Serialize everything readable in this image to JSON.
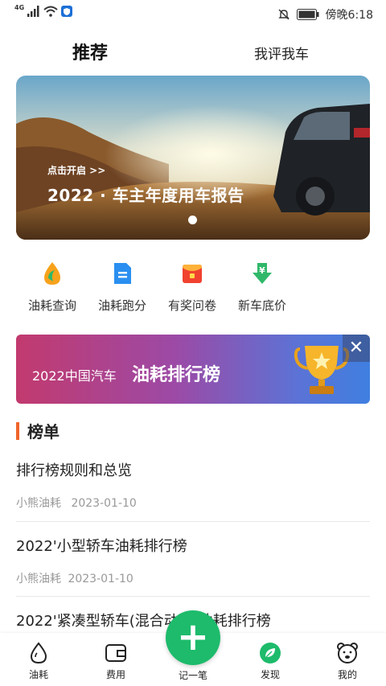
{
  "status_bar": {
    "network": "4G",
    "time": "傍晚6:18"
  },
  "header": {
    "tabs": [
      {
        "label": "推荐",
        "active": true
      },
      {
        "label": "我评我车",
        "active": false
      }
    ]
  },
  "banner": {
    "subtitle": "点击开启 >>",
    "title": "2022 · 车主年度用车报告"
  },
  "quick_actions": [
    {
      "label": "油耗查询",
      "icon": "fuel-drop-icon"
    },
    {
      "label": "油耗跑分",
      "icon": "document-icon"
    },
    {
      "label": "有奖问卷",
      "icon": "red-envelope-icon"
    },
    {
      "label": "新车底价",
      "icon": "yen-download-icon"
    }
  ],
  "rank_banner": {
    "prefix": "2022中国汽车",
    "title": "油耗排行榜",
    "close": "✕"
  },
  "section": {
    "title": "榜单"
  },
  "articles": [
    {
      "title": "排行榜规则和总览",
      "author": "小熊油耗",
      "date": "2023-01-10"
    },
    {
      "title": "2022'小型轿车油耗排行榜",
      "author": "小熊油耗",
      "date": "2023-01-10"
    },
    {
      "title": "2022'紧凑型轿车(混合动力)油耗排行榜",
      "author": "",
      "date": ""
    }
  ],
  "bottom_nav": {
    "items": [
      {
        "label": "油耗",
        "icon": "drop-icon"
      },
      {
        "label": "费用",
        "icon": "wallet-icon"
      },
      {
        "label": "发现",
        "icon": "leaf-icon"
      },
      {
        "label": "我的",
        "icon": "bear-icon"
      }
    ],
    "fab_label": "记一笔",
    "fab_symbol": "+"
  },
  "colors": {
    "accent_green": "#1dbb6b",
    "section_bar": "#f0642a",
    "meta_gray": "#999999"
  }
}
